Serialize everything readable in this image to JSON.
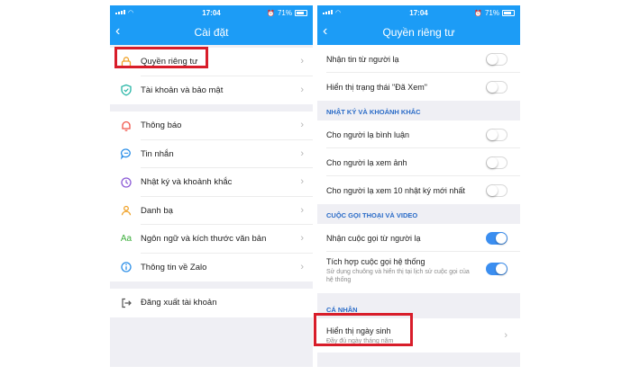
{
  "status_bar": {
    "time": "17:04",
    "battery": "71%"
  },
  "left": {
    "title": "Cài đặt",
    "items": [
      {
        "label": "Quyền riêng tư",
        "icon": "lock-icon"
      },
      {
        "label": "Tài khoản và bảo mật",
        "icon": "shield-icon"
      },
      {
        "label": "Thông báo",
        "icon": "bell-icon"
      },
      {
        "label": "Tin nhắn",
        "icon": "message-icon"
      },
      {
        "label": "Nhật ký và khoảnh khắc",
        "icon": "clock-icon"
      },
      {
        "label": "Danh bạ",
        "icon": "contacts-icon"
      },
      {
        "label": "Ngôn ngữ và kích thước văn bản",
        "icon": "font-size-icon",
        "glyph": "Aa"
      },
      {
        "label": "Thông tin về Zalo",
        "icon": "info-icon"
      },
      {
        "label": "Đăng xuất tài khoản",
        "icon": "logout-icon"
      }
    ]
  },
  "right": {
    "title": "Quyền riêng tư",
    "rows_top": [
      {
        "label": "Nhận tin từ người lạ",
        "on": false
      },
      {
        "label": "Hiển thị trạng thái \"Đã Xem\"",
        "on": false
      }
    ],
    "section_journal": "NHẬT KÝ VÀ KHOẢNH KHẮC",
    "rows_journal": [
      {
        "label": "Cho người lạ bình luận",
        "on": false
      },
      {
        "label": "Cho người lạ xem ảnh",
        "on": false
      },
      {
        "label": "Cho người lạ xem 10 nhật ký mới nhất",
        "on": false
      }
    ],
    "section_calls": "CUỘC GỌI THOẠI VÀ VIDEO",
    "rows_calls": [
      {
        "label": "Nhận cuộc gọi từ người lạ",
        "on": true
      },
      {
        "label": "Tích hợp cuộc gọi hệ thống",
        "sub": "Sử dụng chuông và hiển thị tại lịch sử cuộc gọi của hệ thống",
        "on": true
      }
    ],
    "section_personal": "CÁ NHÂN",
    "birthday": {
      "label": "Hiển thị ngày sinh",
      "sub": "Đầy đủ ngày tháng năm"
    }
  },
  "colors": {
    "header": "#1c9cf6",
    "highlight": "#d81d2a",
    "toggle_on": "#3b8ef0"
  }
}
